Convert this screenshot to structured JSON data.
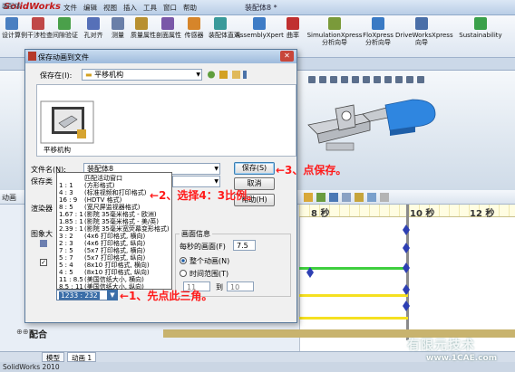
{
  "app": {
    "logo": "SolidWorks",
    "doc_title": "装配体8 *",
    "menus": [
      "文件",
      "编辑",
      "视图",
      "插入",
      "工具",
      "窗口",
      "帮助"
    ]
  },
  "ribbon": {
    "items": [
      {
        "label": "设计算例",
        "icon": "design-study-icon",
        "color": "#4a7fc1"
      },
      {
        "label": "干涉检查",
        "icon": "interference-icon",
        "color": "#c04848"
      },
      {
        "label": "间隙验证",
        "icon": "clearance-icon",
        "color": "#4aa04a"
      },
      {
        "label": "孔对齐",
        "icon": "hole-align-icon",
        "color": "#5670b8"
      },
      {
        "label": "测量",
        "icon": "measure-icon",
        "color": "#6a7fa8"
      },
      {
        "label": "质量属性",
        "icon": "mass-properties-icon",
        "color": "#b89030"
      },
      {
        "label": "剖面属性",
        "icon": "section-properties-icon",
        "color": "#7a58a8"
      },
      {
        "label": "传感器",
        "icon": "sensor-icon",
        "color": "#d6852a"
      },
      {
        "label": "装配体直观",
        "icon": "assembly-visualization-icon",
        "color": "#3a9a9a"
      },
      {
        "label": "AssemblyXpert",
        "icon": "assemblyxpert-icon",
        "color": "#3e7cc6"
      },
      {
        "label": "曲率",
        "icon": "curvature-icon",
        "color": "#c03030"
      },
      {
        "label": "SimulationXpress 分析向导",
        "icon": "simulationxpress-icon",
        "color": "#7a9a3a"
      },
      {
        "label": "FloXpress 分析向导",
        "icon": "floxpress-icon",
        "color": "#3a7ac4"
      },
      {
        "label": "DriveWorksXpress 向导",
        "icon": "driveworksxpress-icon",
        "color": "#4a6fa8"
      },
      {
        "label": "Sustainability",
        "icon": "sustainability-icon",
        "color": "#3aa04a"
      }
    ]
  },
  "cmd_tab": "装配体",
  "motion": {
    "tab_label": "动画",
    "timeline_ticks": [
      "8 秒",
      "10 秒",
      "12 秒"
    ],
    "tree_item": "配合",
    "tabs": [
      "模型",
      "动画 1"
    ]
  },
  "status_text": "SolidWorks 2010",
  "dialog": {
    "title": "保存动画到文件",
    "save_in_label": "保存在(I):",
    "save_in_value": "平移机构",
    "thumbnail_label": "平移机构",
    "filename_label": "文件名(N):",
    "filename_value": "装配体8",
    "savetype_label": "保存类",
    "renderer_label": "渲染器",
    "image_size_label": "图象大",
    "frame_info_label": "画面信息",
    "fps_label": "每秒的画面(F)",
    "fps_value": "7.5",
    "whole_animation": "整个动画(N)",
    "time_range": "时间范围(T)",
    "range_from": "11",
    "range_to_label": "到",
    "range_to": "10",
    "save_button": "保存(S)",
    "cancel_button": "取消",
    "help_button": "帮助(H)",
    "ratio_selected": "1233 : 232",
    "ratio_options": [
      {
        "key": "",
        "desc": "匹配活动窗口"
      },
      {
        "key": "1 : 1",
        "desc": "(方形格式)"
      },
      {
        "key": "4 : 3",
        "desc": "(标准视频和打印格式)"
      },
      {
        "key": "16 : 9",
        "desc": "(HDTV 格式)"
      },
      {
        "key": "8 : 5",
        "desc": "(宽尺屏监视器格式)"
      },
      {
        "key": "1.67 : 1",
        "desc": "(影院 35毫米格式 - 欧洲)"
      },
      {
        "key": "1.85 : 1",
        "desc": "(影院 35毫米格式 - 美/英)"
      },
      {
        "key": "2.39 : 1",
        "desc": "(影院 35毫米宽荧幕变形格式)"
      },
      {
        "key": "3 : 2",
        "desc": "(4x6 打印格式, 横向)"
      },
      {
        "key": "2 : 3",
        "desc": "(4x6 打印格式, 纵向)"
      },
      {
        "key": "7 : 5",
        "desc": "(5x7 打印格式, 横向)"
      },
      {
        "key": "5 : 7",
        "desc": "(5x7 打印格式, 纵向)"
      },
      {
        "key": "5 : 4",
        "desc": "(8x10 打印格式, 横向)"
      },
      {
        "key": "4 : 5",
        "desc": "(8x10 打印格式, 纵向)"
      },
      {
        "key": "11 : 8.5",
        "desc": "(美国信纸大小, 横向)"
      },
      {
        "key": "8.5 : 11",
        "desc": "(美国信纸大小, 纵向)"
      }
    ]
  },
  "annotations": {
    "step1": "←1、先点此三角。",
    "step2": "←2、选择4：3比例。",
    "step3": "←3、点保存。"
  },
  "watermark": {
    "line1": "有限元技术",
    "line2": "www.1CAE.com"
  }
}
